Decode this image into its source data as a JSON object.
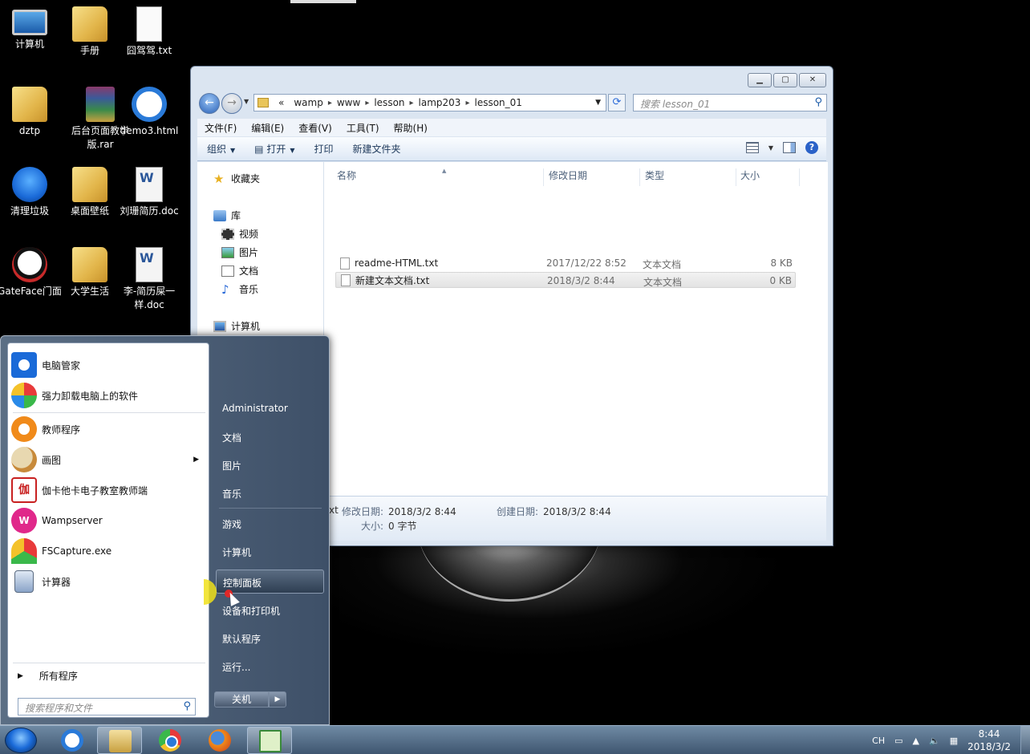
{
  "desktop": {
    "icons": [
      {
        "label": "计算机",
        "icon": "computer-icon"
      },
      {
        "label": "手册",
        "icon": "folder-icon"
      },
      {
        "label": "囧驾驾.txt",
        "icon": "text-file-icon"
      },
      {
        "label": "dztp",
        "icon": "folder-icon"
      },
      {
        "label": "后台页面教学版.rar",
        "icon": "rar-archive-icon"
      },
      {
        "label": "demo3.html",
        "icon": "ie-html-icon"
      },
      {
        "label": "清理垃圾",
        "icon": "broom-icon"
      },
      {
        "label": "桌面壁纸",
        "icon": "folder-icon"
      },
      {
        "label": "刘珊简历.doc",
        "icon": "word-doc-icon"
      },
      {
        "label": "GateFace门面",
        "icon": "panda-icon"
      },
      {
        "label": "大学生活",
        "icon": "folder-icon"
      },
      {
        "label": "李-简历屎一样.doc",
        "icon": "word-doc-icon"
      }
    ]
  },
  "explorer": {
    "breadcrumb": {
      "overflow": "«",
      "segments": [
        "wamp",
        "www",
        "lesson",
        "lamp203",
        "lesson_01"
      ]
    },
    "search_placeholder": "搜索 lesson_01",
    "menu": [
      "文件(F)",
      "编辑(E)",
      "查看(V)",
      "工具(T)",
      "帮助(H)"
    ],
    "toolbar": {
      "organize": "组织",
      "open": "打开",
      "print": "打印",
      "new_folder": "新建文件夹"
    },
    "nav": {
      "favorites": "收藏夹",
      "libraries": "库",
      "videos": "视频",
      "pictures": "图片",
      "documents": "文档",
      "music": "音乐",
      "computer": "计算机"
    },
    "columns": {
      "name": "名称",
      "modified": "修改日期",
      "type": "类型",
      "size": "大小"
    },
    "files": [
      {
        "name": "readme-HTML.txt",
        "modified": "2017/12/22 8:52",
        "type": "文本文档",
        "size": "8 KB",
        "selected": false
      },
      {
        "name": "新建文本文档.txt",
        "modified": "2018/3/2 8:44",
        "type": "文本文档",
        "size": "0 KB",
        "selected": true
      }
    ],
    "details": {
      "name_fragment": "xt",
      "modified_label": "修改日期:",
      "modified_value": "2018/3/2 8:44",
      "created_label": "创建日期:",
      "created_value": "2018/3/2 8:44",
      "size_label": "大小:",
      "size_value": "0 字节"
    }
  },
  "startmenu": {
    "pinned": [
      {
        "label": "电脑管家",
        "icon": "shield-guard-icon"
      },
      {
        "label": "强力卸载电脑上的软件",
        "icon": "uninstall-icon"
      }
    ],
    "recent": [
      {
        "label": "教师程序",
        "icon": "teacher-program-icon",
        "has_submenu": false
      },
      {
        "label": "画图",
        "icon": "paint-icon",
        "has_submenu": true
      },
      {
        "label": "伽卡他卡电子教室教师端",
        "icon": "jiakatak-icon",
        "has_submenu": false
      },
      {
        "label": "Wampserver",
        "icon": "wampserver-icon",
        "has_submenu": false
      },
      {
        "label": "FSCapture.exe",
        "icon": "fscapture-icon",
        "has_submenu": false
      },
      {
        "label": "计算器",
        "icon": "calculator-icon",
        "has_submenu": false
      }
    ],
    "all_programs": "所有程序",
    "search_placeholder": "搜索程序和文件",
    "right": {
      "user": "Administrator",
      "documents": "文档",
      "pictures": "图片",
      "music": "音乐",
      "games": "游戏",
      "computer": "计算机",
      "control_panel": "控制面板",
      "devices": "设备和打印机",
      "default_programs": "默认程序",
      "run": "运行..."
    },
    "shutdown": "关机"
  },
  "taskbar": {
    "apps": [
      "internet-explorer",
      "windows-explorer",
      "chrome",
      "firefox",
      "notepad-plus-plus"
    ],
    "tray": {
      "lang": "CH"
    },
    "clock": {
      "time": "8:44",
      "date": "2018/3/2"
    }
  }
}
